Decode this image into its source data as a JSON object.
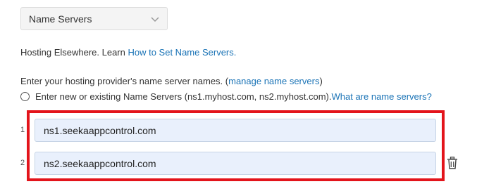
{
  "dropdown": {
    "selected": "Name Servers",
    "icon": "chevron-down-icon"
  },
  "hosting": {
    "text": "Hosting Elsewhere. Learn ",
    "link": "How to Set Name Servers."
  },
  "instructions": {
    "text": "Enter your hosting provider's name server names. (",
    "link": "manage name servers",
    "close": ")"
  },
  "radio_option": {
    "text": "Enter new or existing Name Servers (ns1.myhost.com, ns2.myhost.com). ",
    "link": "What are name servers?"
  },
  "nameservers": [
    {
      "index": "1",
      "value": "ns1.seekaappcontrol.com"
    },
    {
      "index": "2",
      "value": "ns2.seekaappcontrol.com"
    }
  ],
  "delete_icon": "trash-icon",
  "colors": {
    "link": "#1a73b6",
    "highlight": "#e3141b",
    "input_bg": "#e9f0fc"
  }
}
